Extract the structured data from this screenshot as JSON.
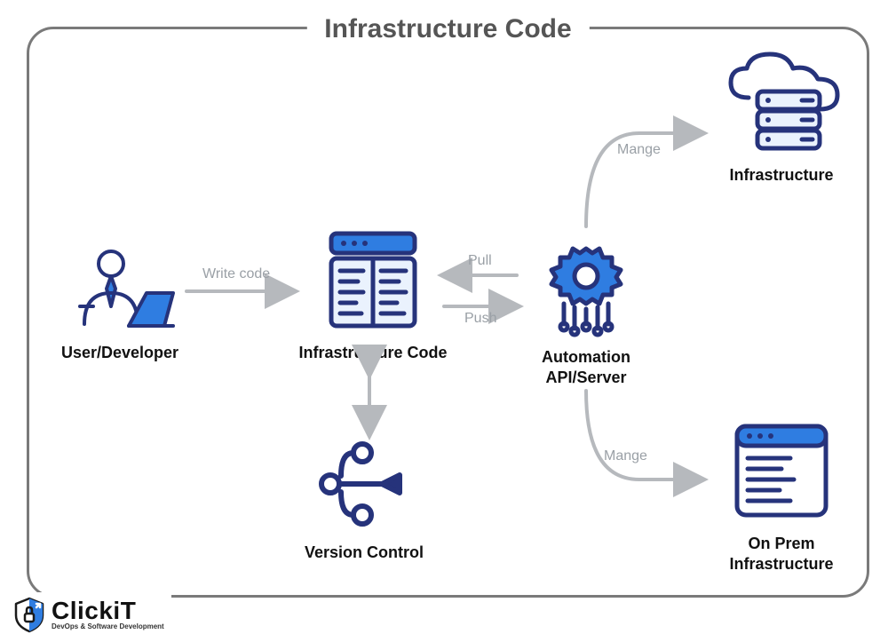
{
  "title": "Infrastructure Code",
  "nodes": {
    "user": "User/Developer",
    "iac": "Infrastructure Code",
    "automation_line1": "Automation",
    "automation_line2": "API/Server",
    "vcs": "Version Control",
    "infra": "Infrastructure",
    "onprem_line1": "On Prem",
    "onprem_line2": "Infrastructure"
  },
  "edges": {
    "write_code": "Write code",
    "pull": "Pull",
    "push": "Push",
    "manage_top": "Mange",
    "manage_bottom": "Mange"
  },
  "logo": {
    "brand": "ClickiT",
    "tagline": "DevOps & Software Development"
  }
}
